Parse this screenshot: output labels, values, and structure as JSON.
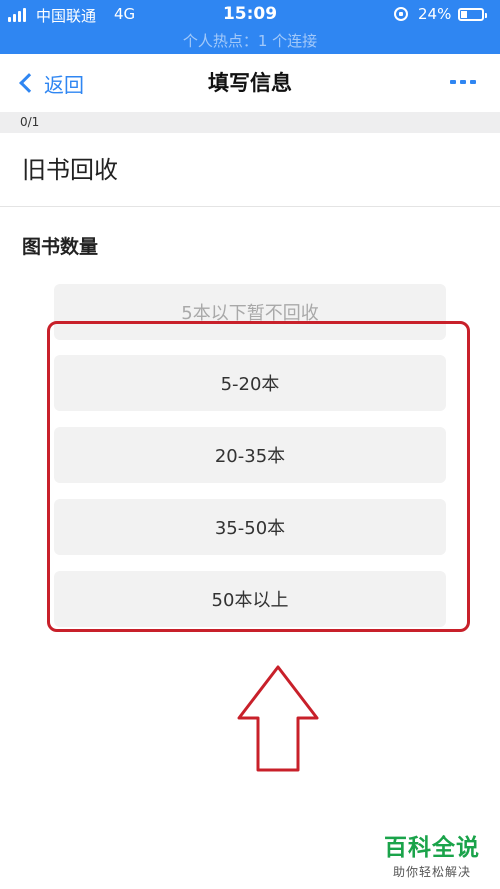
{
  "status_bar": {
    "carrier": "中国联通",
    "network": "4G",
    "time": "15:09",
    "battery": "24%",
    "hotspot": "个人热点：1 个连接"
  },
  "nav": {
    "back_label": "返回",
    "title": "填写信息"
  },
  "progress": "0/1",
  "section_title": "旧书回收",
  "field_label": "图书数量",
  "options": [
    "5本以下暂不回收",
    "5-20本",
    "20-35本",
    "35-50本",
    "50本以上"
  ],
  "watermark": {
    "title": "百科全说",
    "subtitle": "助你轻松解决"
  },
  "colors": {
    "accent": "#2f86f2",
    "annotation": "#c8202a",
    "watermark": "#1aa34a"
  },
  "icons": [
    "chevron-left-icon",
    "more-icon",
    "lock-rotation-icon",
    "battery-icon",
    "signal-icon"
  ]
}
